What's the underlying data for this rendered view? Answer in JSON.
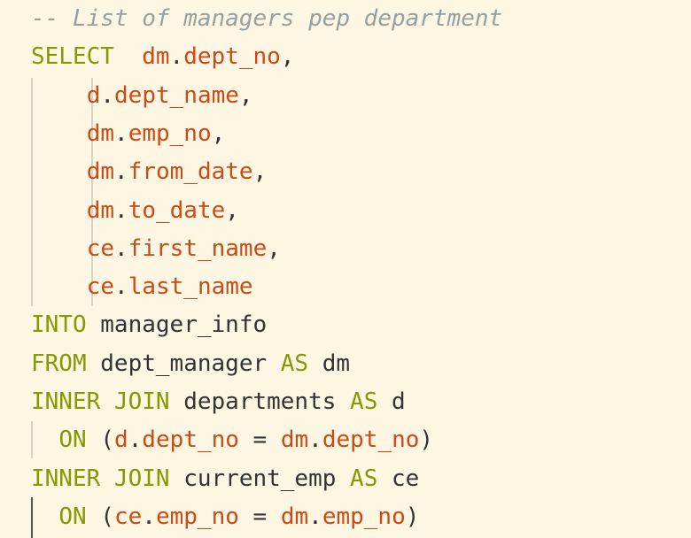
{
  "editor": {
    "lines": [
      {
        "name": "comment-line",
        "indent": 1,
        "tokens": [
          {
            "t": "comment",
            "v": "-- List of managers pep department"
          }
        ]
      },
      {
        "name": "select-line",
        "indent": 1,
        "tokens": [
          {
            "t": "kw",
            "v": "SELECT"
          },
          {
            "t": "ws",
            "v": "  "
          },
          {
            "t": "col",
            "v": "dm"
          },
          {
            "t": "punct",
            "v": "."
          },
          {
            "t": "col",
            "v": "dept_no"
          },
          {
            "t": "punct",
            "v": ","
          }
        ]
      },
      {
        "name": "select-column-line",
        "indent": 5,
        "tokens": [
          {
            "t": "col",
            "v": "d"
          },
          {
            "t": "punct",
            "v": "."
          },
          {
            "t": "col",
            "v": "dept_name"
          },
          {
            "t": "punct",
            "v": ","
          }
        ]
      },
      {
        "name": "select-column-line",
        "indent": 5,
        "tokens": [
          {
            "t": "col",
            "v": "dm"
          },
          {
            "t": "punct",
            "v": "."
          },
          {
            "t": "col",
            "v": "emp_no"
          },
          {
            "t": "punct",
            "v": ","
          }
        ]
      },
      {
        "name": "select-column-line",
        "indent": 5,
        "tokens": [
          {
            "t": "col",
            "v": "dm"
          },
          {
            "t": "punct",
            "v": "."
          },
          {
            "t": "col",
            "v": "from_date"
          },
          {
            "t": "punct",
            "v": ","
          }
        ]
      },
      {
        "name": "select-column-line",
        "indent": 5,
        "tokens": [
          {
            "t": "col",
            "v": "dm"
          },
          {
            "t": "punct",
            "v": "."
          },
          {
            "t": "col",
            "v": "to_date"
          },
          {
            "t": "punct",
            "v": ","
          }
        ]
      },
      {
        "name": "select-column-line",
        "indent": 5,
        "tokens": [
          {
            "t": "col",
            "v": "ce"
          },
          {
            "t": "punct",
            "v": "."
          },
          {
            "t": "col",
            "v": "first_name"
          },
          {
            "t": "punct",
            "v": ","
          }
        ]
      },
      {
        "name": "select-column-line",
        "indent": 5,
        "tokens": [
          {
            "t": "col",
            "v": "ce"
          },
          {
            "t": "punct",
            "v": "."
          },
          {
            "t": "col",
            "v": "last_name"
          }
        ]
      },
      {
        "name": "into-line",
        "indent": 1,
        "tokens": [
          {
            "t": "kw",
            "v": "INTO"
          },
          {
            "t": "ws",
            "v": " "
          },
          {
            "t": "ident",
            "v": "manager_info"
          }
        ]
      },
      {
        "name": "from-line",
        "indent": 1,
        "tokens": [
          {
            "t": "kw",
            "v": "FROM"
          },
          {
            "t": "ws",
            "v": " "
          },
          {
            "t": "ident",
            "v": "dept_manager"
          },
          {
            "t": "ws",
            "v": " "
          },
          {
            "t": "kw",
            "v": "AS"
          },
          {
            "t": "ws",
            "v": " "
          },
          {
            "t": "ident",
            "v": "dm"
          }
        ]
      },
      {
        "name": "join-line",
        "indent": 1,
        "tokens": [
          {
            "t": "kw",
            "v": "INNER JOIN"
          },
          {
            "t": "ws",
            "v": " "
          },
          {
            "t": "ident",
            "v": "departments"
          },
          {
            "t": "ws",
            "v": " "
          },
          {
            "t": "kw",
            "v": "AS"
          },
          {
            "t": "ws",
            "v": " "
          },
          {
            "t": "ident",
            "v": "d"
          }
        ]
      },
      {
        "name": "on-line",
        "indent": 3,
        "tokens": [
          {
            "t": "kw",
            "v": "ON"
          },
          {
            "t": "ws",
            "v": " "
          },
          {
            "t": "punct",
            "v": "("
          },
          {
            "t": "col",
            "v": "d"
          },
          {
            "t": "punct",
            "v": "."
          },
          {
            "t": "col",
            "v": "dept_no"
          },
          {
            "t": "ws",
            "v": " "
          },
          {
            "t": "op",
            "v": "="
          },
          {
            "t": "ws",
            "v": " "
          },
          {
            "t": "col",
            "v": "dm"
          },
          {
            "t": "punct",
            "v": "."
          },
          {
            "t": "col",
            "v": "dept_no"
          },
          {
            "t": "punct",
            "v": ")"
          }
        ]
      },
      {
        "name": "join-line",
        "indent": 1,
        "tokens": [
          {
            "t": "kw",
            "v": "INNER JOIN"
          },
          {
            "t": "ws",
            "v": " "
          },
          {
            "t": "ident",
            "v": "current_emp"
          },
          {
            "t": "ws",
            "v": " "
          },
          {
            "t": "kw",
            "v": "AS"
          },
          {
            "t": "ws",
            "v": " "
          },
          {
            "t": "ident",
            "v": "ce"
          }
        ]
      },
      {
        "name": "on-line",
        "indent": 3,
        "tokens": [
          {
            "t": "kw",
            "v": "ON"
          },
          {
            "t": "ws",
            "v": " "
          },
          {
            "t": "punct",
            "v": "("
          },
          {
            "t": "col",
            "v": "ce"
          },
          {
            "t": "punct",
            "v": "."
          },
          {
            "t": "col",
            "v": "emp_no"
          },
          {
            "t": "ws",
            "v": " "
          },
          {
            "t": "op",
            "v": "="
          },
          {
            "t": "ws",
            "v": " "
          },
          {
            "t": "col",
            "v": "dm"
          },
          {
            "t": "punct",
            "v": "."
          },
          {
            "t": "col",
            "v": "emp_no"
          },
          {
            "t": "punct",
            "v": ")"
          }
        ]
      }
    ],
    "colors": {
      "background": "#fdf6e3",
      "keyword": "#859900",
      "column": "#cb4b16",
      "comment": "#93a1a1",
      "text": "#333333",
      "guide": "#d8d2c0"
    }
  }
}
